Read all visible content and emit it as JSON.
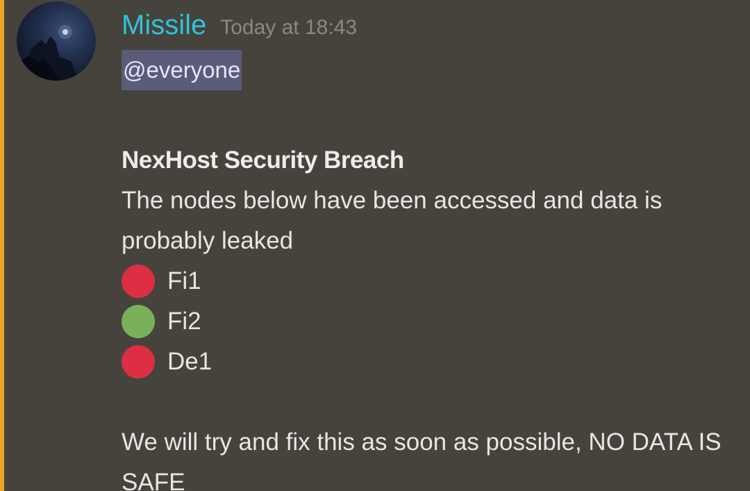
{
  "message": {
    "author": "Missile",
    "timestamp": "Today at 18:43",
    "mention": "@everyone",
    "title": "NexHost Security Breach",
    "intro": "The nodes below have been accessed and data is probably leaked",
    "nodes": [
      {
        "label": "Fi1",
        "status": "red",
        "icon": "red-circle-icon"
      },
      {
        "label": "Fi2",
        "status": "green",
        "icon": "green-circle-icon"
      },
      {
        "label": "De1",
        "status": "red",
        "icon": "red-circle-icon"
      }
    ],
    "closing": "We will try and fix this as soon as possible, NO DATA IS SAFE"
  },
  "colors": {
    "background": "#46433d",
    "mention_bar": "#f0a521",
    "username": "#2fc4da",
    "mention_bg": "#5b5c79",
    "red": "#dd2e44",
    "green": "#78b159"
  }
}
